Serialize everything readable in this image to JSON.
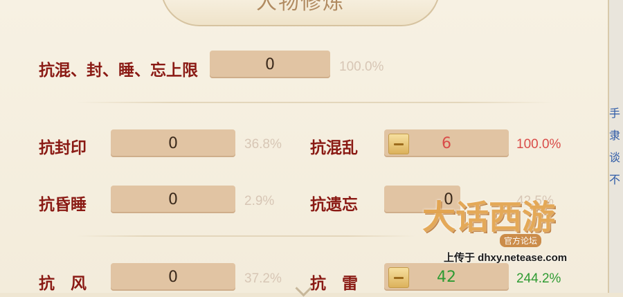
{
  "title": "人物修炼",
  "rows": {
    "limit": {
      "label": "抗混、封、睡、忘上限",
      "value": "0",
      "percent": "100.0%"
    },
    "seal": {
      "label": "抗封印",
      "value": "0",
      "percent": "36.8%"
    },
    "chaos": {
      "label": "抗混乱",
      "value": "6",
      "percent": "100.0%"
    },
    "sleep": {
      "label": "抗昏睡",
      "value": "0",
      "percent": "2.9%"
    },
    "forget": {
      "label": "抗遗忘",
      "value": "0",
      "percent": "42.5%"
    },
    "wind": {
      "label": "抗　风",
      "value": "0",
      "percent": "37.2%"
    },
    "thunder": {
      "label": "抗　雷",
      "value": "42",
      "percent": "244.2%"
    }
  },
  "side_text": [
    "手",
    "隶",
    "谈",
    "不"
  ],
  "watermark": {
    "logo": "大话西游",
    "sub": "官方论坛",
    "url": "上传于 dhxy.netease.com"
  },
  "colors": {
    "label": "#8a1a14",
    "value_red": "#d94c49",
    "value_green": "#2e9b32",
    "box": "#e1c4a3"
  }
}
